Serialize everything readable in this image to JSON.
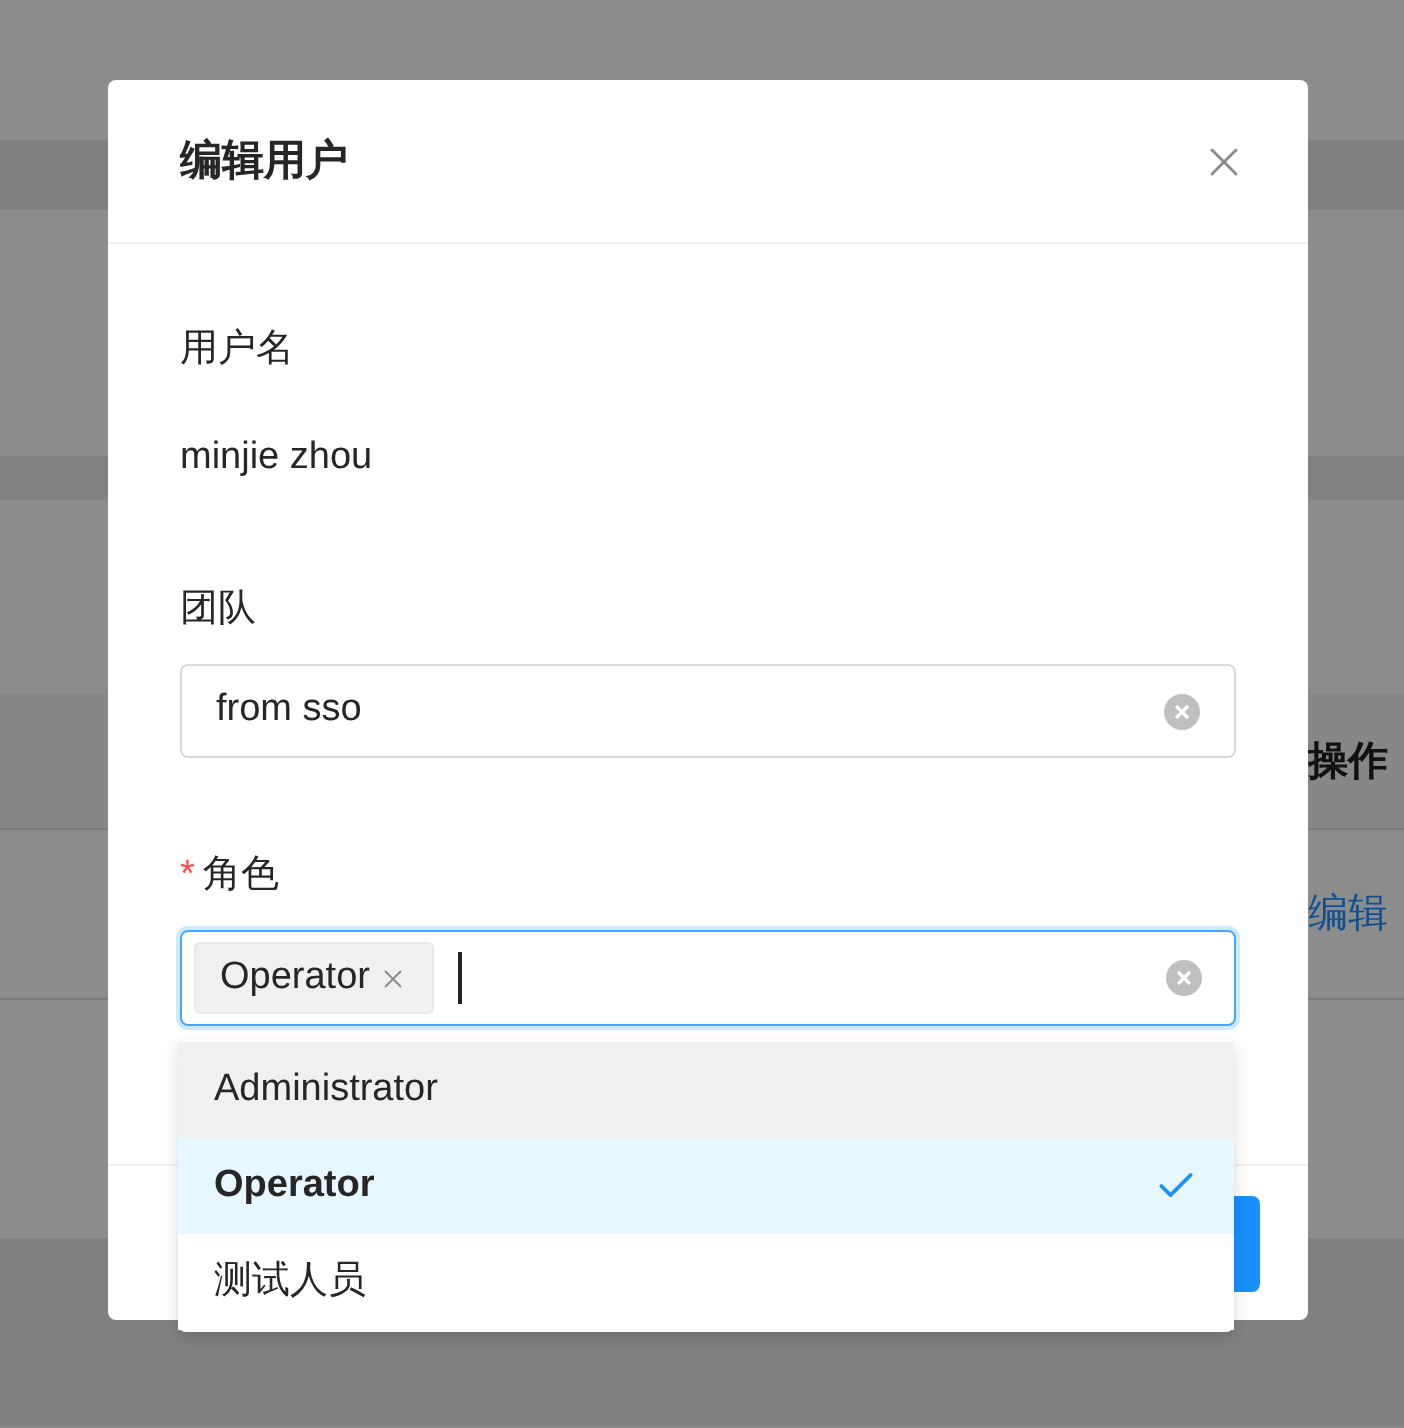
{
  "background": {
    "column_header": "操作",
    "row_action": "编辑"
  },
  "dialog": {
    "title": "编辑用户",
    "fields": [
      {
        "kind": "text",
        "label": "用户名",
        "value": "minjie zhou"
      },
      {
        "kind": "select",
        "label": "团队",
        "value": "from sso"
      },
      {
        "kind": "multi",
        "label": "角色",
        "required_mark": "*",
        "focused": true,
        "tags": [
          "Operator"
        ]
      }
    ]
  },
  "dropdown": {
    "options": [
      {
        "label": "Administrator",
        "selected": false,
        "hovered": true
      },
      {
        "label": "Operator",
        "selected": true,
        "hovered": false
      },
      {
        "label": "测试人员",
        "selected": false,
        "hovered": false
      }
    ]
  }
}
